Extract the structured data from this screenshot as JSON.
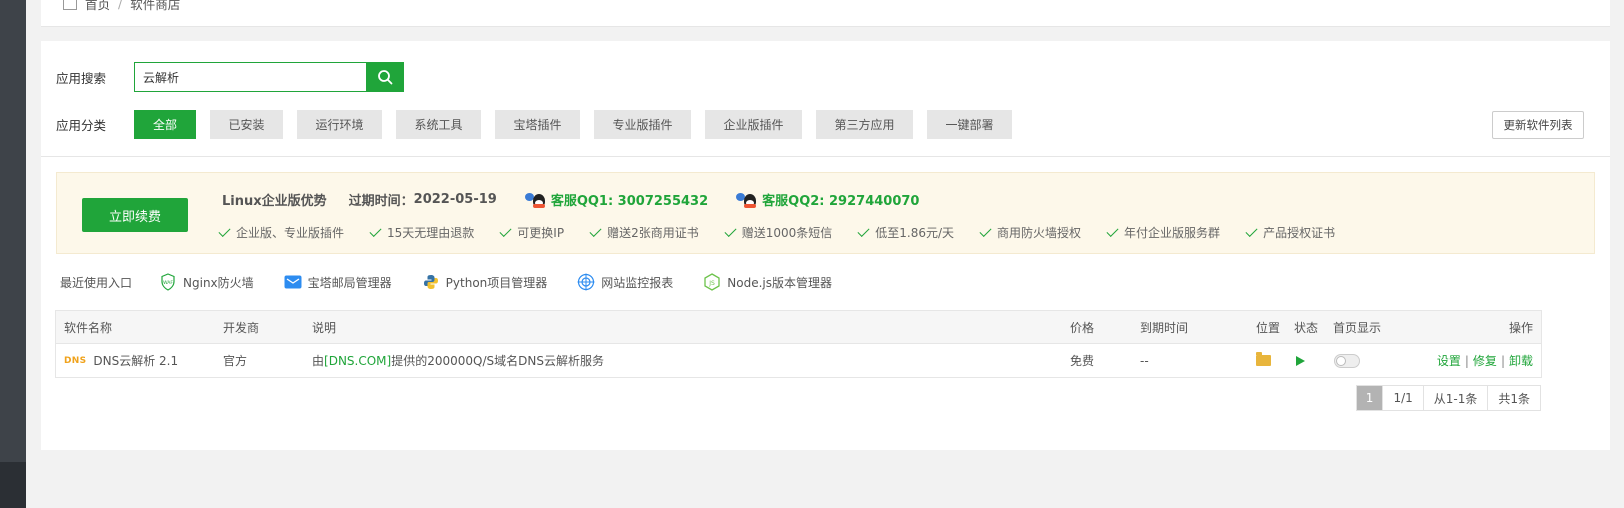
{
  "breadcrumb": {
    "home": "首页",
    "separator": "/",
    "current": "软件商店"
  },
  "search": {
    "label": "应用搜索",
    "value": "云解析"
  },
  "categories": {
    "label": "应用分类",
    "items": [
      "全部",
      "已安装",
      "运行环境",
      "系统工具",
      "宝塔插件",
      "专业版插件",
      "企业版插件",
      "第三方应用",
      "一键部署"
    ],
    "active_index": 0
  },
  "refresh_label": "更新软件列表",
  "promo": {
    "renew_label": "立即续费",
    "title": "Linux企业版优势",
    "expiry_label": "过期时间：",
    "expiry_value": "2022-05-19",
    "qq1": "客服QQ1: 3007255432",
    "qq2": "客服QQ2: 2927440070",
    "features": [
      "企业版、专业版插件",
      "15天无理由退款",
      "可更换IP",
      "赠送2张商用证书",
      "赠送1000条短信",
      "低至1.86元/天",
      "商用防火墙授权",
      "年付企业版服务群",
      "产品授权证书"
    ]
  },
  "recent": {
    "label": "最近使用入口",
    "items": [
      {
        "name": "Nginx防火墙",
        "icon": "waf-shield-icon"
      },
      {
        "name": "宝塔邮局管理器",
        "icon": "mail-icon"
      },
      {
        "name": "Python项目管理器",
        "icon": "python-icon"
      },
      {
        "name": "网站监控报表",
        "icon": "monitor-target-icon"
      },
      {
        "name": "Node.js版本管理器",
        "icon": "nodejs-icon"
      }
    ]
  },
  "table": {
    "headers": {
      "name": "软件名称",
      "dev": "开发商",
      "desc": "说明",
      "price": "价格",
      "expire": "到期时间",
      "location": "位置",
      "status": "状态",
      "home": "首页显示",
      "ops": "操作"
    },
    "rows": [
      {
        "logo": "DNS",
        "name": "DNS云解析 2.1",
        "dev": "官方",
        "desc_prefix": "由",
        "desc_link": "[DNS.COM]",
        "desc_suffix": "提供的200000Q/S域名DNS云解析服务",
        "price": "免费",
        "expire": "--",
        "op_settings": "设置",
        "op_repair": "修复",
        "op_uninstall": "卸载"
      }
    ]
  },
  "pager": {
    "current": "1",
    "pages": "1/1",
    "range": "从1-1条",
    "total": "共1条"
  },
  "colors": {
    "primary": "#20a53a",
    "promo_bg": "#fdf8ea"
  }
}
